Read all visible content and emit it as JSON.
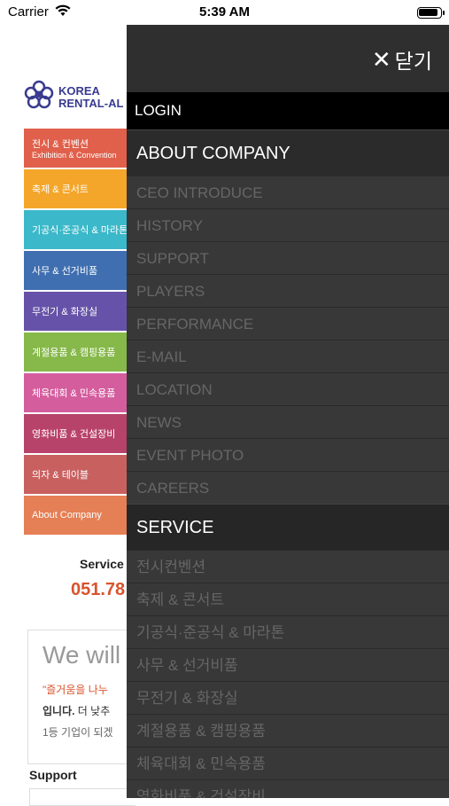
{
  "status_bar": {
    "carrier": "Carrier",
    "time": "5:39 AM"
  },
  "logo": {
    "line1": "KOREA",
    "line2": "RENTAL-AL"
  },
  "categories": [
    {
      "l1": "전시 & 컨벤션",
      "l2": "Exhibition & Convention",
      "color": "#e0604b"
    },
    {
      "l1": "축제 & 콘서트",
      "l2": "",
      "color": "#f4a62a"
    },
    {
      "l1": "기공식·준공식 & 마라톤",
      "l2": "",
      "color": "#3bb8c9"
    },
    {
      "l1": "사무 & 선거비품",
      "l2": "",
      "color": "#3f6fb0"
    },
    {
      "l1": "무전기 & 화장실",
      "l2": "",
      "color": "#6652a8"
    },
    {
      "l1": "계절용품 & 캠핑용품",
      "l2": "",
      "color": "#86b84a"
    },
    {
      "l1": "체육대회 & 민속용품",
      "l2": "",
      "color": "#d45d9e"
    },
    {
      "l1": "영화비품 & 건설장비",
      "l2": "",
      "color": "#b8436a"
    },
    {
      "l1": "의자 & 테이블",
      "l2": "",
      "color": "#c96060"
    },
    {
      "l1": "About Company",
      "l2": "",
      "color": "#e57f55"
    }
  ],
  "service": {
    "label": "Service",
    "phone": "051.78"
  },
  "promo": {
    "heading": "We will",
    "quote": "\"즐거움을 나누",
    "bold_text": "입니다.",
    "text1": " 더 낮추",
    "text2": "1등 기업이 되겠"
  },
  "support": {
    "label": "Support"
  },
  "drawer": {
    "close_label": "닫기",
    "login": "LOGIN",
    "about_heading": "ABOUT COMPANY",
    "about_items": [
      "CEO INTRODUCE",
      "HISTORY",
      "SUPPORT",
      "PLAYERS",
      "PERFORMANCE",
      "E-MAIL",
      "LOCATION",
      "NEWS",
      "EVENT PHOTO",
      "CAREERS"
    ],
    "service_heading": "SERVICE",
    "service_items": [
      "전시컨벤션",
      "축제 & 콘서트",
      "기공식·준공식 & 마라톤",
      "사무 & 선거비품",
      "무전기 & 화장실",
      "계절용품 & 캠핑용품",
      "체육대회 & 민속용품",
      "영화비품 & 건설장비"
    ]
  },
  "icons": {
    "wifi": "wifi-icon",
    "battery": "battery-icon",
    "close": "close-icon",
    "logo": "flower-logo-icon"
  }
}
